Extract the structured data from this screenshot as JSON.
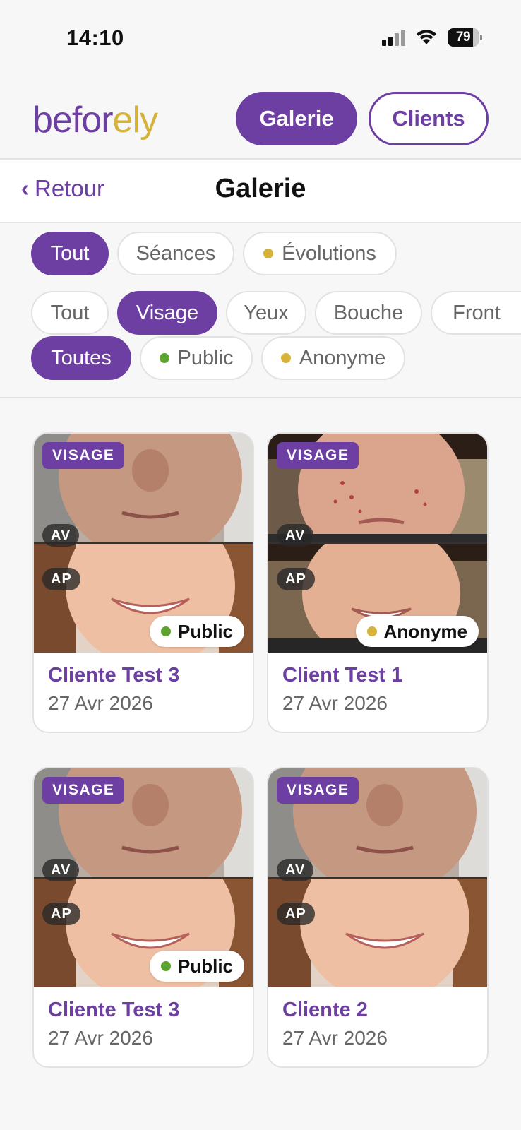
{
  "status_bar": {
    "time": "14:10",
    "battery": "79"
  },
  "header": {
    "logo_main": "befor",
    "logo_accent": "ely",
    "nav": {
      "galerie": "Galerie",
      "clients": "Clients"
    }
  },
  "page": {
    "back_label": "Retour",
    "title": "Galerie"
  },
  "filters": {
    "type": [
      {
        "label": "Tout",
        "active": true
      },
      {
        "label": "Séances",
        "active": false
      },
      {
        "label": "Évolutions",
        "active": false,
        "dot": "#d6b23a"
      }
    ],
    "zone": [
      {
        "label": "Tout",
        "active": false
      },
      {
        "label": "Visage",
        "active": true
      },
      {
        "label": "Yeux",
        "active": false
      },
      {
        "label": "Bouche",
        "active": false
      },
      {
        "label": "Front",
        "active": false
      }
    ],
    "visibility": [
      {
        "label": "Toutes",
        "active": true
      },
      {
        "label": "Public",
        "active": false,
        "dot": "#5ca32f"
      },
      {
        "label": "Anonyme",
        "active": false,
        "dot": "#d6b23a"
      }
    ]
  },
  "cards": [
    {
      "tag": "VISAGE",
      "before": "AV",
      "after": "AP",
      "status": "Public",
      "status_color": "#5ca32f",
      "name": "Cliente Test 3",
      "date": "27 Avr 2026"
    },
    {
      "tag": "VISAGE",
      "before": "AV",
      "after": "AP",
      "status": "Anonyme",
      "status_color": "#d6b23a",
      "name": "Client Test 1",
      "date": "27 Avr 2026"
    },
    {
      "tag": "VISAGE",
      "before": "AV",
      "after": "AP",
      "status": "Public",
      "status_color": "#5ca32f",
      "name": "Cliente Test 3",
      "date": "27 Avr 2026"
    },
    {
      "tag": "VISAGE",
      "before": "AV",
      "after": "AP",
      "status": "",
      "name": "Cliente 2",
      "date": "27 Avr 2026"
    }
  ],
  "colors": {
    "brand": "#6e3fa3",
    "accent": "#d6b23a",
    "public": "#5ca32f"
  }
}
